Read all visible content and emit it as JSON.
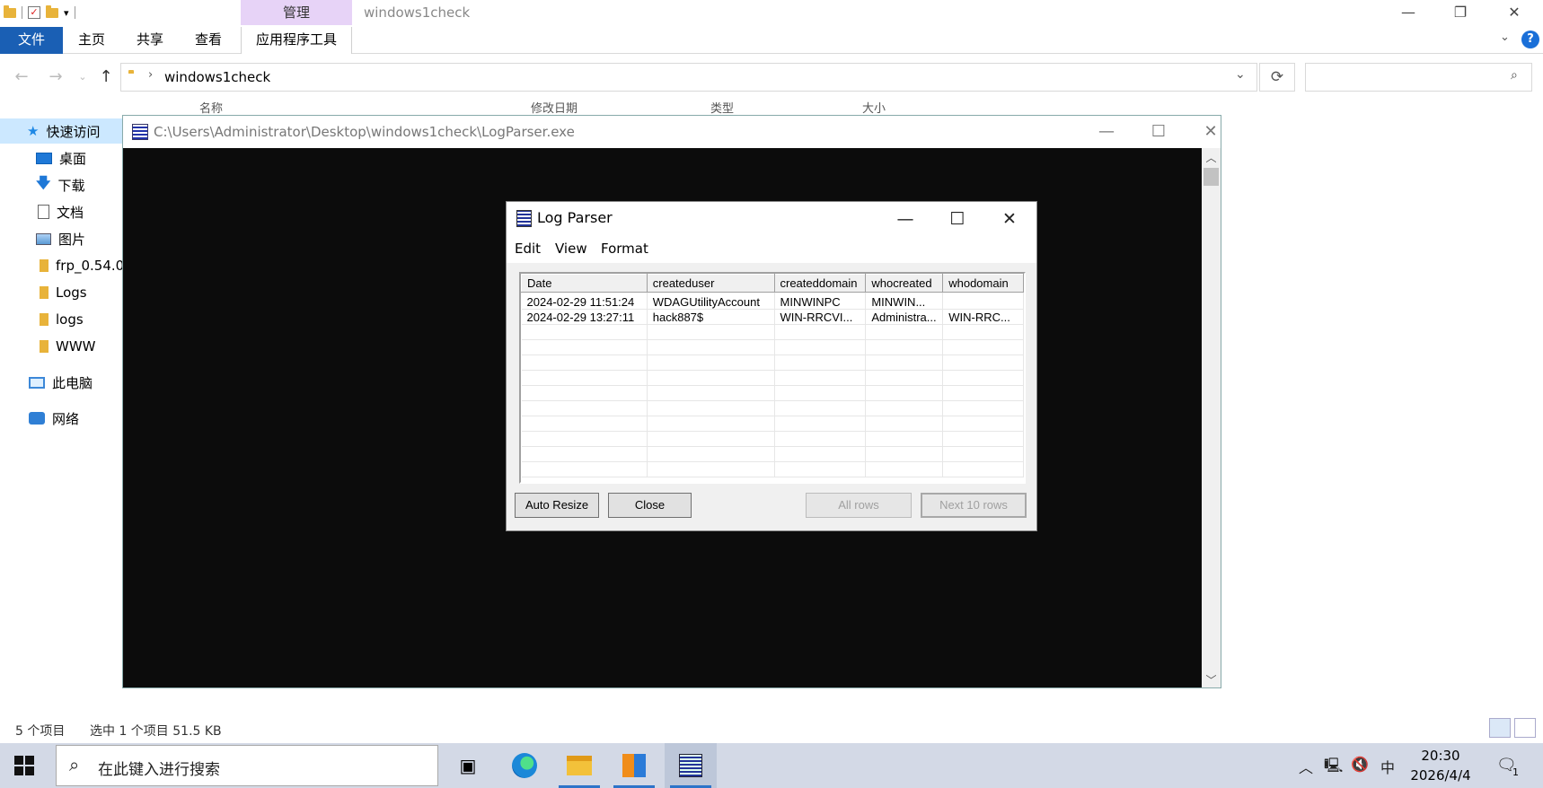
{
  "explorer": {
    "title": "windows1check",
    "context_tab": "管理",
    "ribbon": {
      "file": "文件",
      "home": "主页",
      "share": "共享",
      "view": "查看",
      "app_tools": "应用程序工具"
    },
    "address": "windows1check",
    "search_placeholder": "",
    "columns": [
      "名称",
      "修改日期",
      "类型",
      "大小"
    ],
    "nav": [
      {
        "label": "快速访问",
        "icon": "star-icon"
      },
      {
        "label": "桌面",
        "icon": "desktop-icon"
      },
      {
        "label": "下载",
        "icon": "download-icon"
      },
      {
        "label": "文档",
        "icon": "document-icon"
      },
      {
        "label": "图片",
        "icon": "pictures-icon"
      },
      {
        "label": "frp_0.54.0",
        "icon": "folder-icon"
      },
      {
        "label": "Logs",
        "icon": "folder-icon"
      },
      {
        "label": "logs",
        "icon": "folder-icon"
      },
      {
        "label": "WWW",
        "icon": "folder-icon"
      },
      {
        "label": "此电脑",
        "icon": "computer-icon"
      },
      {
        "label": "网络",
        "icon": "network-icon"
      }
    ],
    "status": {
      "count": "5 个项目",
      "selection": "选中 1 个项目  51.5 KB"
    }
  },
  "console": {
    "title": "C:\\Users\\Administrator\\Desktop\\windows1check\\LogParser.exe"
  },
  "logparser": {
    "title": "Log Parser",
    "menu": [
      "Edit",
      "View",
      "Format"
    ],
    "columns": [
      "Date",
      "createduser",
      "createddomain",
      "whocreated",
      "whodomain"
    ],
    "rows": [
      [
        "2024-02-29 11:51:24",
        "WDAGUtilityAccount",
        "MINWINPC",
        "MINWIN...",
        ""
      ],
      [
        "2024-02-29 13:27:11",
        "hack887$",
        "WIN-RRCVI...",
        "Administra...",
        "WIN-RRC..."
      ]
    ],
    "buttons": {
      "auto_resize": "Auto Resize",
      "close": "Close",
      "all_rows": "All rows",
      "next_rows": "Next 10 rows"
    }
  },
  "taskbar": {
    "search_placeholder": "在此键入进行搜索",
    "ime": "中",
    "time": "20:30",
    "date": "2026/4/4",
    "notification_count": "1"
  }
}
